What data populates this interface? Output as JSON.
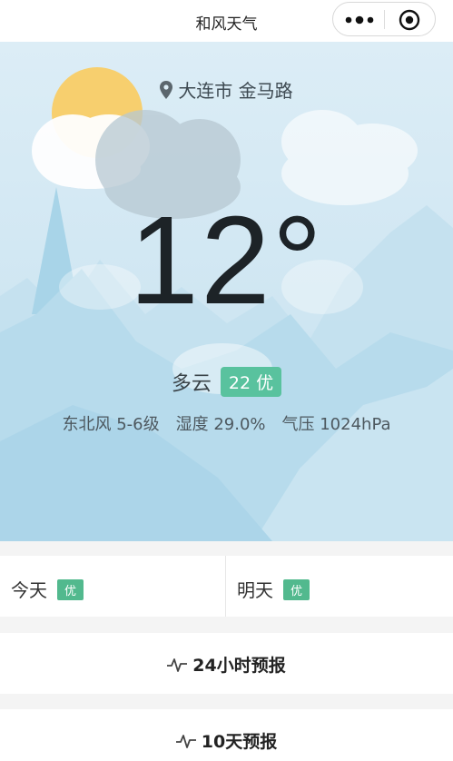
{
  "app": {
    "title": "和风天气"
  },
  "capsule": {
    "more_icon": "more-dots-icon",
    "close_icon": "close-circle-icon"
  },
  "current": {
    "location": "大连市 金马路",
    "temperature": "12°",
    "condition": "多云",
    "aqi_badge": "22 优",
    "wind": "东北风 5-6级",
    "humidity": "湿度 29.0%",
    "pressure": "气压 1024hPa"
  },
  "forecast_days": [
    {
      "label": "今天",
      "badge": "优"
    },
    {
      "label": "明天",
      "badge": "优"
    }
  ],
  "links": {
    "hourly": "24小时预报",
    "daily": "10天预报"
  },
  "colors": {
    "aqi_green": "#59c29e",
    "badge_green": "#52b98e",
    "sky": "#cfe6f2",
    "sun": "#f7cf6e"
  }
}
